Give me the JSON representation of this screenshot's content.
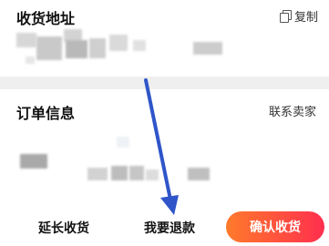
{
  "address": {
    "title": "收货地址",
    "copy_label": "复制"
  },
  "order": {
    "title": "订单信息",
    "contact_label": "联系卖家"
  },
  "bottom": {
    "extend_label": "延长收货",
    "refund_label": "我要退款",
    "confirm_label": "确认收货"
  },
  "colors": {
    "confirm_gradient_start": "#ff7a2b",
    "confirm_gradient_end": "#ff2f4e",
    "annotation_arrow": "#2f55c9"
  }
}
